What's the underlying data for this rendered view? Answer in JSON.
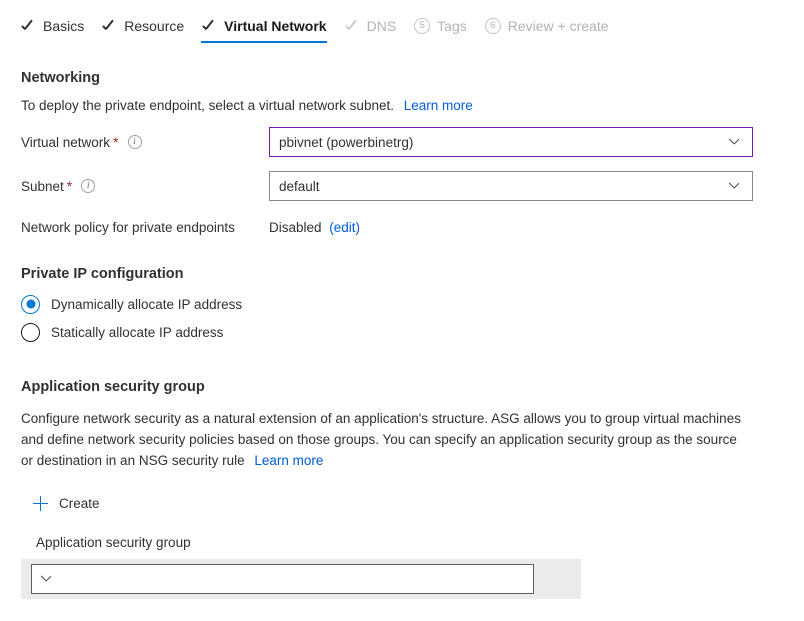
{
  "wizard": {
    "tabs": [
      {
        "label": "Basics",
        "state": "done",
        "marker": "check"
      },
      {
        "label": "Resource",
        "state": "done",
        "marker": "check"
      },
      {
        "label": "Virtual Network",
        "state": "active",
        "marker": "check"
      },
      {
        "label": "DNS",
        "state": "disabled",
        "marker": "check"
      },
      {
        "label": "Tags",
        "state": "disabled",
        "marker": "5"
      },
      {
        "label": "Review + create",
        "state": "disabled",
        "marker": "6"
      }
    ]
  },
  "networking": {
    "heading": "Networking",
    "description": "To deploy the private endpoint, select a virtual network subnet.",
    "learn_more": "Learn more",
    "virtual_network": {
      "label": "Virtual network",
      "required_marker": "*",
      "info_icon": "info-icon",
      "value": "pbivnet (powerbinetrg)"
    },
    "subnet": {
      "label": "Subnet",
      "required_marker": "*",
      "info_icon": "info-icon",
      "value": "default"
    },
    "network_policy": {
      "label": "Network policy for private endpoints",
      "value": "Disabled",
      "edit_link": "(edit)"
    }
  },
  "private_ip": {
    "heading": "Private IP configuration",
    "options": [
      {
        "label": "Dynamically allocate IP address",
        "checked": true
      },
      {
        "label": "Statically allocate IP address",
        "checked": false
      }
    ]
  },
  "asg": {
    "heading": "Application security group",
    "paragraph": "Configure network security as a natural extension of an application's structure. ASG allows you to group virtual machines and define network security policies based on those groups. You can specify an application security group as the source or destination in an NSG security rule",
    "learn_more": "Learn more",
    "create_button": "Create",
    "create_icon": "plus-icon",
    "field_label": "Application security group",
    "field_value": "",
    "field_placeholder": ""
  },
  "colors": {
    "accent_blue": "#0078d4",
    "link_blue": "#015cda",
    "focus_purple": "#7719aa",
    "required_red": "#a4262c",
    "band_gray": "#ebebe9",
    "text": "#323130"
  }
}
